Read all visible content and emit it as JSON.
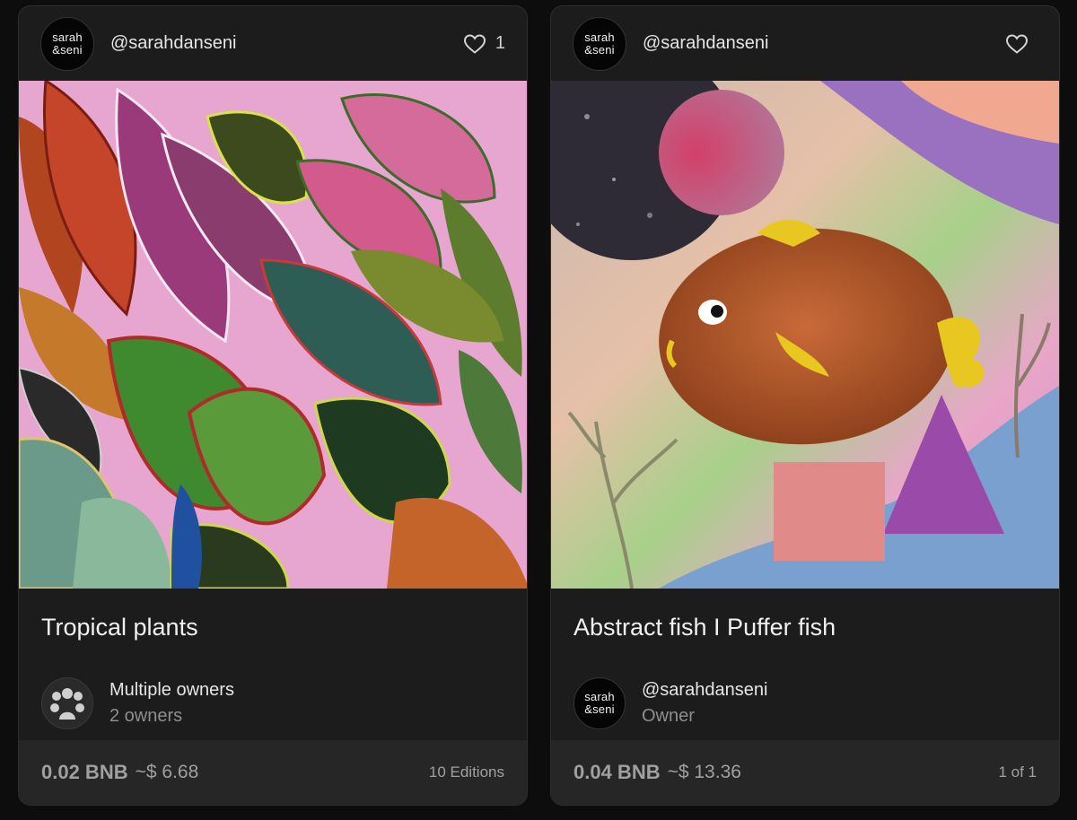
{
  "cards": [
    {
      "creator_avatar_line1": "sarah",
      "creator_avatar_line2": "&seni",
      "handle": "@sarahdanseni",
      "likes": "1",
      "heart_icon": "heart-outline-icon",
      "title": "Tropical plants",
      "owner_primary": "Multiple owners",
      "owner_secondary": "2 owners",
      "owner_icon": "group-icon",
      "price_bnb": "0.02 BNB",
      "price_usd": "~$ 6.68",
      "editions": "10 Editions"
    },
    {
      "creator_avatar_line1": "sarah",
      "creator_avatar_line2": "&seni",
      "handle": "@sarahdanseni",
      "likes": "",
      "heart_icon": "heart-outline-icon",
      "title": "Abstract fish I Puffer fish",
      "owner_avatar_line1": "sarah",
      "owner_avatar_line2": "&seni",
      "owner_primary": "@sarahdanseni",
      "owner_secondary": "Owner",
      "price_bnb": "0.04 BNB",
      "price_usd": "~$ 13.36",
      "editions": "1 of 1"
    }
  ],
  "colors": {
    "page_background": "#0d0d0d",
    "card_background": "#1c1c1c",
    "price_bar_background": "#262626",
    "muted_text": "#8e8e8e"
  }
}
